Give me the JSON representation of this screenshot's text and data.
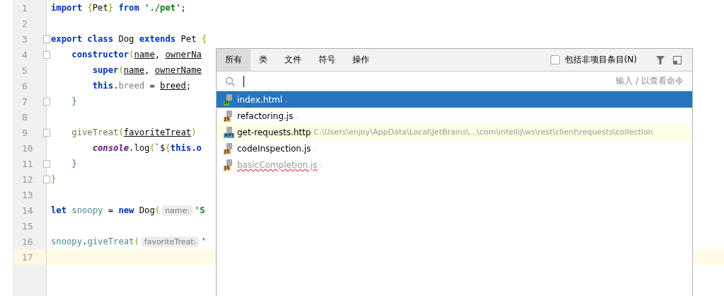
{
  "editor": {
    "lines": [
      {
        "number": "1",
        "fold": false,
        "current": false,
        "tokens": [
          {
            "kind": "keyword",
            "text": "import "
          },
          {
            "kind": "brace",
            "text": "{"
          },
          {
            "kind": "plain",
            "text": "Pet"
          },
          {
            "kind": "brace",
            "text": "}"
          },
          {
            "kind": "keyword",
            "text": " from "
          },
          {
            "kind": "string",
            "text": "'./pet'"
          },
          {
            "kind": "plain",
            "text": ";"
          }
        ]
      },
      {
        "number": "2",
        "fold": false,
        "current": false
      },
      {
        "number": "3",
        "fold": true,
        "current": false,
        "tokens": [
          {
            "kind": "keyword",
            "text": "export class "
          },
          {
            "kind": "plain",
            "text": "Dog "
          },
          {
            "kind": "keyword",
            "text": "extends "
          },
          {
            "kind": "plain",
            "text": "Pet "
          },
          {
            "kind": "brace",
            "text": "{"
          }
        ]
      },
      {
        "number": "4",
        "fold": true,
        "current": false,
        "tokens": [
          {
            "kind": "keyword",
            "text": "    constructor"
          },
          {
            "kind": "brace",
            "text": "("
          },
          {
            "kind": "param",
            "text": "name"
          },
          {
            "kind": "plain",
            "text": ", "
          },
          {
            "kind": "param",
            "text": "ownerNa"
          }
        ]
      },
      {
        "number": "5",
        "fold": false,
        "current": false,
        "tokens": [
          {
            "kind": "keyword",
            "text": "        super"
          },
          {
            "kind": "brace",
            "text": "("
          },
          {
            "kind": "param",
            "text": "name"
          },
          {
            "kind": "plain",
            "text": ", "
          },
          {
            "kind": "param",
            "text": "ownerName"
          }
        ]
      },
      {
        "number": "6",
        "fold": false,
        "current": false,
        "tokens": [
          {
            "kind": "keyword",
            "text": "        this"
          },
          {
            "kind": "plain",
            "text": "."
          },
          {
            "kind": "member",
            "text": "breed"
          },
          {
            "kind": "plain",
            "text": " = "
          },
          {
            "kind": "param",
            "text": "breed"
          },
          {
            "kind": "plain",
            "text": ";"
          }
        ]
      },
      {
        "number": "7",
        "fold": true,
        "current": false,
        "tokens": [
          {
            "kind": "brace2",
            "text": "    }"
          }
        ]
      },
      {
        "number": "8",
        "fold": false,
        "current": false
      },
      {
        "number": "9",
        "fold": true,
        "current": false,
        "tokens": [
          {
            "kind": "method",
            "text": "    giveTreat"
          },
          {
            "kind": "brace",
            "text": "("
          },
          {
            "kind": "param",
            "text": "favoriteTreat"
          },
          {
            "kind": "brace",
            "text": ")"
          }
        ]
      },
      {
        "number": "10",
        "fold": false,
        "current": false,
        "tokens": [
          {
            "kind": "global",
            "text": "        console"
          },
          {
            "kind": "plain",
            "text": ".log"
          },
          {
            "kind": "brace",
            "text": "("
          },
          {
            "kind": "string",
            "text": "`"
          },
          {
            "kind": "plain",
            "text": "$"
          },
          {
            "kind": "brace",
            "text": "{"
          },
          {
            "kind": "keyword",
            "text": "this.o"
          }
        ]
      },
      {
        "number": "11",
        "fold": true,
        "current": false,
        "tokens": [
          {
            "kind": "brace2",
            "text": "    }"
          }
        ]
      },
      {
        "number": "12",
        "fold": true,
        "current": false,
        "tokens": [
          {
            "kind": "brace",
            "text": "}"
          }
        ]
      },
      {
        "number": "13",
        "fold": false,
        "current": false
      },
      {
        "number": "14",
        "fold": false,
        "current": false,
        "tokens": [
          {
            "kind": "keyword",
            "text": "let "
          },
          {
            "kind": "ident",
            "text": "snoopy"
          },
          {
            "kind": "plain",
            "text": " = "
          },
          {
            "kind": "keyword",
            "text": "new "
          },
          {
            "kind": "plain",
            "text": "Dog"
          },
          {
            "kind": "brace",
            "text": "("
          },
          {
            "kind": "hint",
            "text": "name:"
          },
          {
            "kind": "string",
            "text": "'S"
          }
        ]
      },
      {
        "number": "15",
        "fold": false,
        "current": false
      },
      {
        "number": "16",
        "fold": false,
        "current": false,
        "tokens": [
          {
            "kind": "ident",
            "text": "snoopy"
          },
          {
            "kind": "plain",
            "text": "."
          },
          {
            "kind": "ident",
            "text": "giveTreat"
          },
          {
            "kind": "brace",
            "text": "("
          },
          {
            "kind": "hint",
            "text": "favoriteTreat:"
          },
          {
            "kind": "string",
            "text": "'"
          }
        ]
      },
      {
        "number": "17",
        "fold": false,
        "current": true
      }
    ]
  },
  "popup": {
    "tabs": [
      {
        "label": "所有",
        "selected": true
      },
      {
        "label": "类",
        "selected": false
      },
      {
        "label": "文件",
        "selected": false
      },
      {
        "label": "符号",
        "selected": false
      },
      {
        "label": "操作",
        "selected": false
      }
    ],
    "include_checkbox": {
      "label": "包括非项目条目(N)",
      "checked": false
    },
    "search": {
      "hint": "输入 / 以查看命令"
    },
    "results": [
      {
        "name": "index.html",
        "location": ".",
        "badge": "H",
        "color": "#5fb85a",
        "selected": true,
        "tinted": false,
        "error": false
      },
      {
        "name": "refactoring.js",
        "location": ".",
        "badge": "JS",
        "color": "#f0b35a",
        "selected": false,
        "tinted": false,
        "error": false
      },
      {
        "name": "get-requests.http",
        "location": "C:\\Users\\enjoy\\AppData\\Local\\JetBrains\\...\\com\\intellij\\ws\\rest\\client\\requests\\collection",
        "badge": "API",
        "color": "#56a6d8",
        "selected": false,
        "tinted": true,
        "error": false
      },
      {
        "name": "codeInspection.js",
        "location": ".",
        "badge": "JS",
        "color": "#f0b35a",
        "selected": false,
        "tinted": false,
        "error": false
      },
      {
        "name": "basicCompletion.js",
        "location": ".",
        "badge": "JS",
        "color": "#f0b35a",
        "selected": false,
        "tinted": false,
        "error": true
      }
    ]
  }
}
